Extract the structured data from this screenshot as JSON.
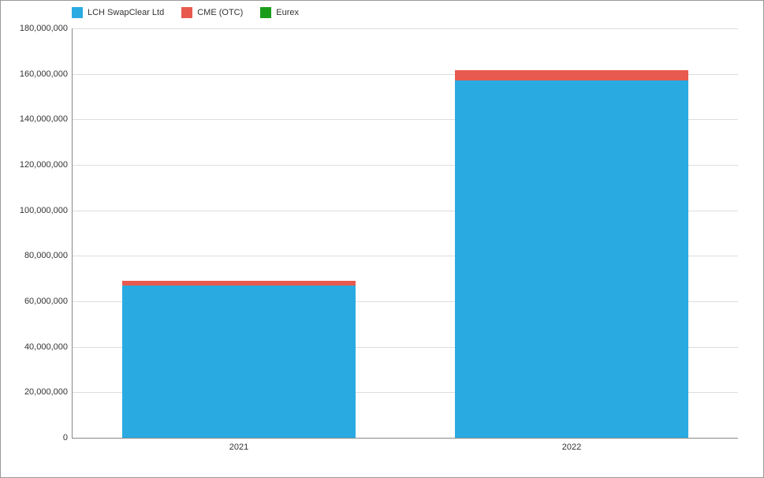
{
  "chart_data": {
    "type": "bar",
    "stacked": true,
    "categories": [
      "2021",
      "2022"
    ],
    "series": [
      {
        "name": "LCH SwapClear Ltd",
        "color": "#29abe2",
        "values": [
          67000000,
          157000000
        ]
      },
      {
        "name": "CME (OTC)",
        "color": "#e85a4f",
        "values": [
          2000000,
          4500000
        ]
      },
      {
        "name": "Eurex",
        "color": "#1a9d1a",
        "values": [
          0,
          0
        ]
      }
    ],
    "ylim": [
      0,
      180000000
    ],
    "y_tick_step": 20000000,
    "y_ticks": [
      0,
      20000000,
      40000000,
      60000000,
      80000000,
      100000000,
      120000000,
      140000000,
      160000000,
      180000000
    ],
    "xlabel": "",
    "ylabel": "",
    "title": ""
  },
  "legend": {
    "items": [
      {
        "label": "LCH SwapClear Ltd",
        "color": "#29abe2"
      },
      {
        "label": "CME (OTC)",
        "color": "#e85a4f"
      },
      {
        "label": "Eurex",
        "color": "#1a9d1a"
      }
    ]
  }
}
